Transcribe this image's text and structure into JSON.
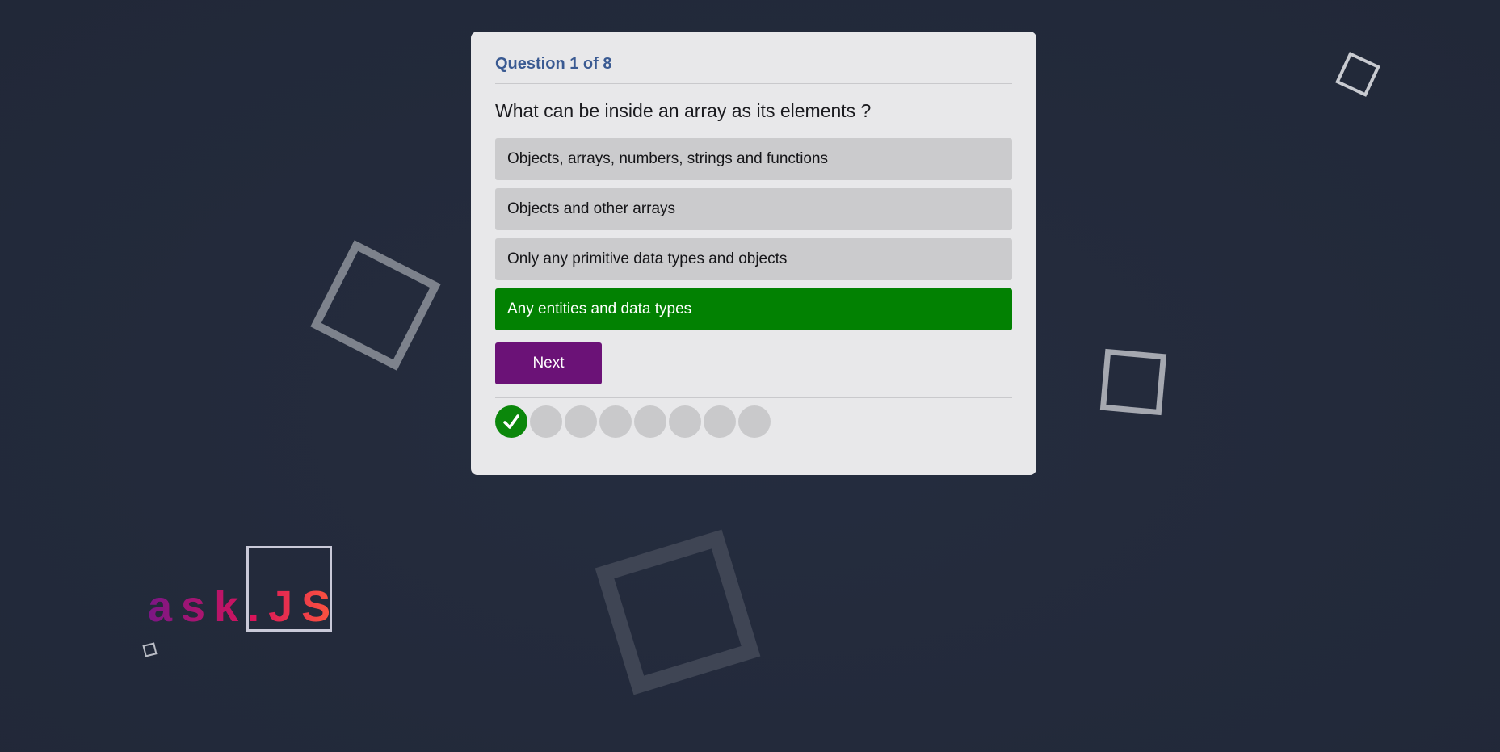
{
  "quiz": {
    "counter": "Question 1 of 8",
    "question": "What can be inside an array as its elements ?",
    "answers": [
      {
        "label": "Objects, arrays, numbers, strings and functions",
        "state": "default"
      },
      {
        "label": "Objects and other arrays",
        "state": "default"
      },
      {
        "label": "Only any primitive data types and objects",
        "state": "default"
      },
      {
        "label": "Any entities and data types",
        "state": "correct"
      }
    ],
    "next_label": "Next",
    "progress": {
      "total": 8,
      "completed": 1,
      "completed_icon": "checkmark-icon"
    }
  },
  "logo": {
    "text": "ask.JS"
  },
  "colors": {
    "background": "#232a3b",
    "card": "#e8e8ea",
    "counter": "#3a5a92",
    "answer_default": "#cbcbcd",
    "answer_correct": "#028102",
    "next_button": "#6b1277",
    "progress_done": "#0b870b",
    "progress_pending": "#c9c9cb",
    "logo_gradient": [
      "#7a1685",
      "#d8145a",
      "#ff5a3c"
    ]
  }
}
